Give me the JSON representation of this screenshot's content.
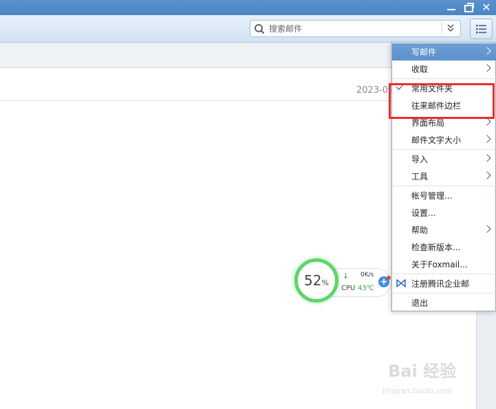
{
  "search": {
    "placeholder": "搜索邮件"
  },
  "content": {
    "date_partial": "2023-09"
  },
  "menu": {
    "items": [
      {
        "label": "写邮件",
        "submenu": true,
        "active": true
      },
      {
        "label": "收取",
        "submenu": true
      },
      {
        "label": "常用文件夹",
        "checked": true
      },
      {
        "label": "往来邮件边栏"
      },
      {
        "label": "界面布局",
        "submenu": true
      },
      {
        "label": "邮件文字大小",
        "submenu": true
      },
      {
        "label": "导入",
        "submenu": true
      },
      {
        "label": "工具",
        "submenu": true
      },
      {
        "label": "帐号管理..."
      },
      {
        "label": "设置..."
      },
      {
        "label": "帮助",
        "submenu": true
      },
      {
        "label": "检查新版本..."
      },
      {
        "label": "关于Foxmail..."
      },
      {
        "label": "注册腾讯企业邮",
        "icon": "tencent-exmail-icon"
      },
      {
        "label": "退出"
      }
    ]
  },
  "monitor": {
    "percent": "52",
    "percent_unit": "%",
    "net_speed": "0K/s",
    "cpu_label": "CPU",
    "cpu_temp": "43℃"
  },
  "watermark": {
    "brand": "Bai 经验",
    "url": "jingyan.baidu.com"
  },
  "colors": {
    "highlight": "#f02b2b",
    "menu_active": "#5c90ca",
    "monitor_ring": "#60d46a"
  }
}
